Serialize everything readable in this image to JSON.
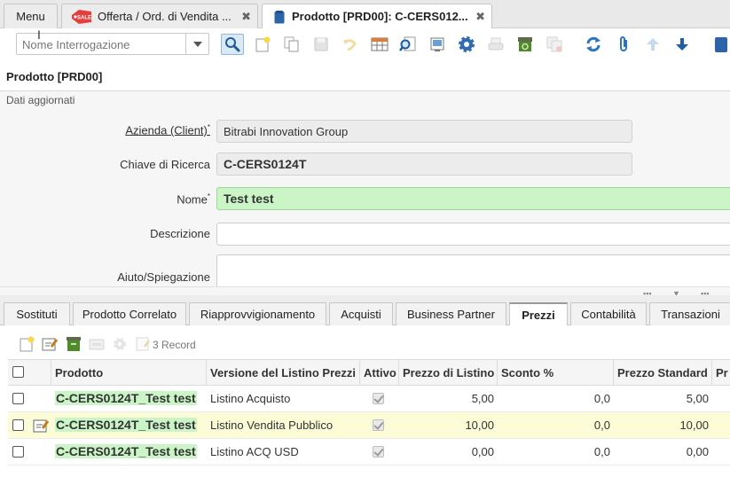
{
  "tabs": [
    {
      "label": "Menu"
    },
    {
      "label": "Offerta / Ord. di Vendita ...",
      "badge": "SALE"
    },
    {
      "label": "Prodotto [PRD00]: C-CERS012..."
    }
  ],
  "toolbar": {
    "query_placeholder": "Nome Interrogazione",
    "icons": [
      "search-icon",
      "new-record-icon",
      "copy-record-icon",
      "save-icon",
      "undo-icon",
      "grid-toggle-icon",
      "zoom-icon",
      "report-icon",
      "process-gear-icon",
      "print-icon",
      "archive-icon",
      "attachment-copy-icon",
      "refresh-icon",
      "paperclip-icon",
      "arrow-up-icon",
      "arrow-down-icon",
      "product-icon"
    ]
  },
  "window": {
    "title": "Prodotto [PRD00]",
    "status": "Dati aggiornati"
  },
  "form": {
    "client_label": "Azienda (Client)",
    "client_value": "Bitrabi Innovation Group",
    "key_label": "Chiave di Ricerca",
    "key_value": "C-CERS0124T",
    "name_label": "Nome",
    "name_value": "Test test",
    "desc_label": "Descrizione",
    "desc_value": "",
    "help_label": "Aiuto/Spiegazione",
    "help_value": "",
    "required_mark": "*"
  },
  "detail_tabs": [
    "Sostituti",
    "Prodotto Correlato",
    "Riapprovvigionamento",
    "Acquisti",
    "Business Partner",
    "Prezzi",
    "Contabilità",
    "Transazioni"
  ],
  "active_detail_tab": "Prezzi",
  "grid": {
    "record_count": "3 Record",
    "columns": [
      "Prodotto",
      "Versione del Listino Prezzi",
      "Attivo",
      "Prezzo di Listino",
      "Sconto %",
      "Prezzo Standard",
      "Pr"
    ],
    "rows": [
      {
        "product": "C-CERS0124T_Test test",
        "price_list_version": "Listino Acquisto",
        "active": true,
        "list_price": "5,00",
        "discount": "0,0",
        "standard_price": "5,00"
      },
      {
        "product": "C-CERS0124T_Test test",
        "price_list_version": "Listino Vendita Pubblico",
        "active": true,
        "list_price": "10,00",
        "discount": "0,0",
        "standard_price": "10,00"
      },
      {
        "product": "C-CERS0124T_Test test",
        "price_list_version": "Listino ACQ USD",
        "active": true,
        "list_price": "0,00",
        "discount": "0,0",
        "standard_price": "0,00"
      }
    ]
  },
  "colors": {
    "green_field": "#cbf5c7",
    "selected_row": "#fcfcd6",
    "icon_blue": "#2b6cb0"
  }
}
